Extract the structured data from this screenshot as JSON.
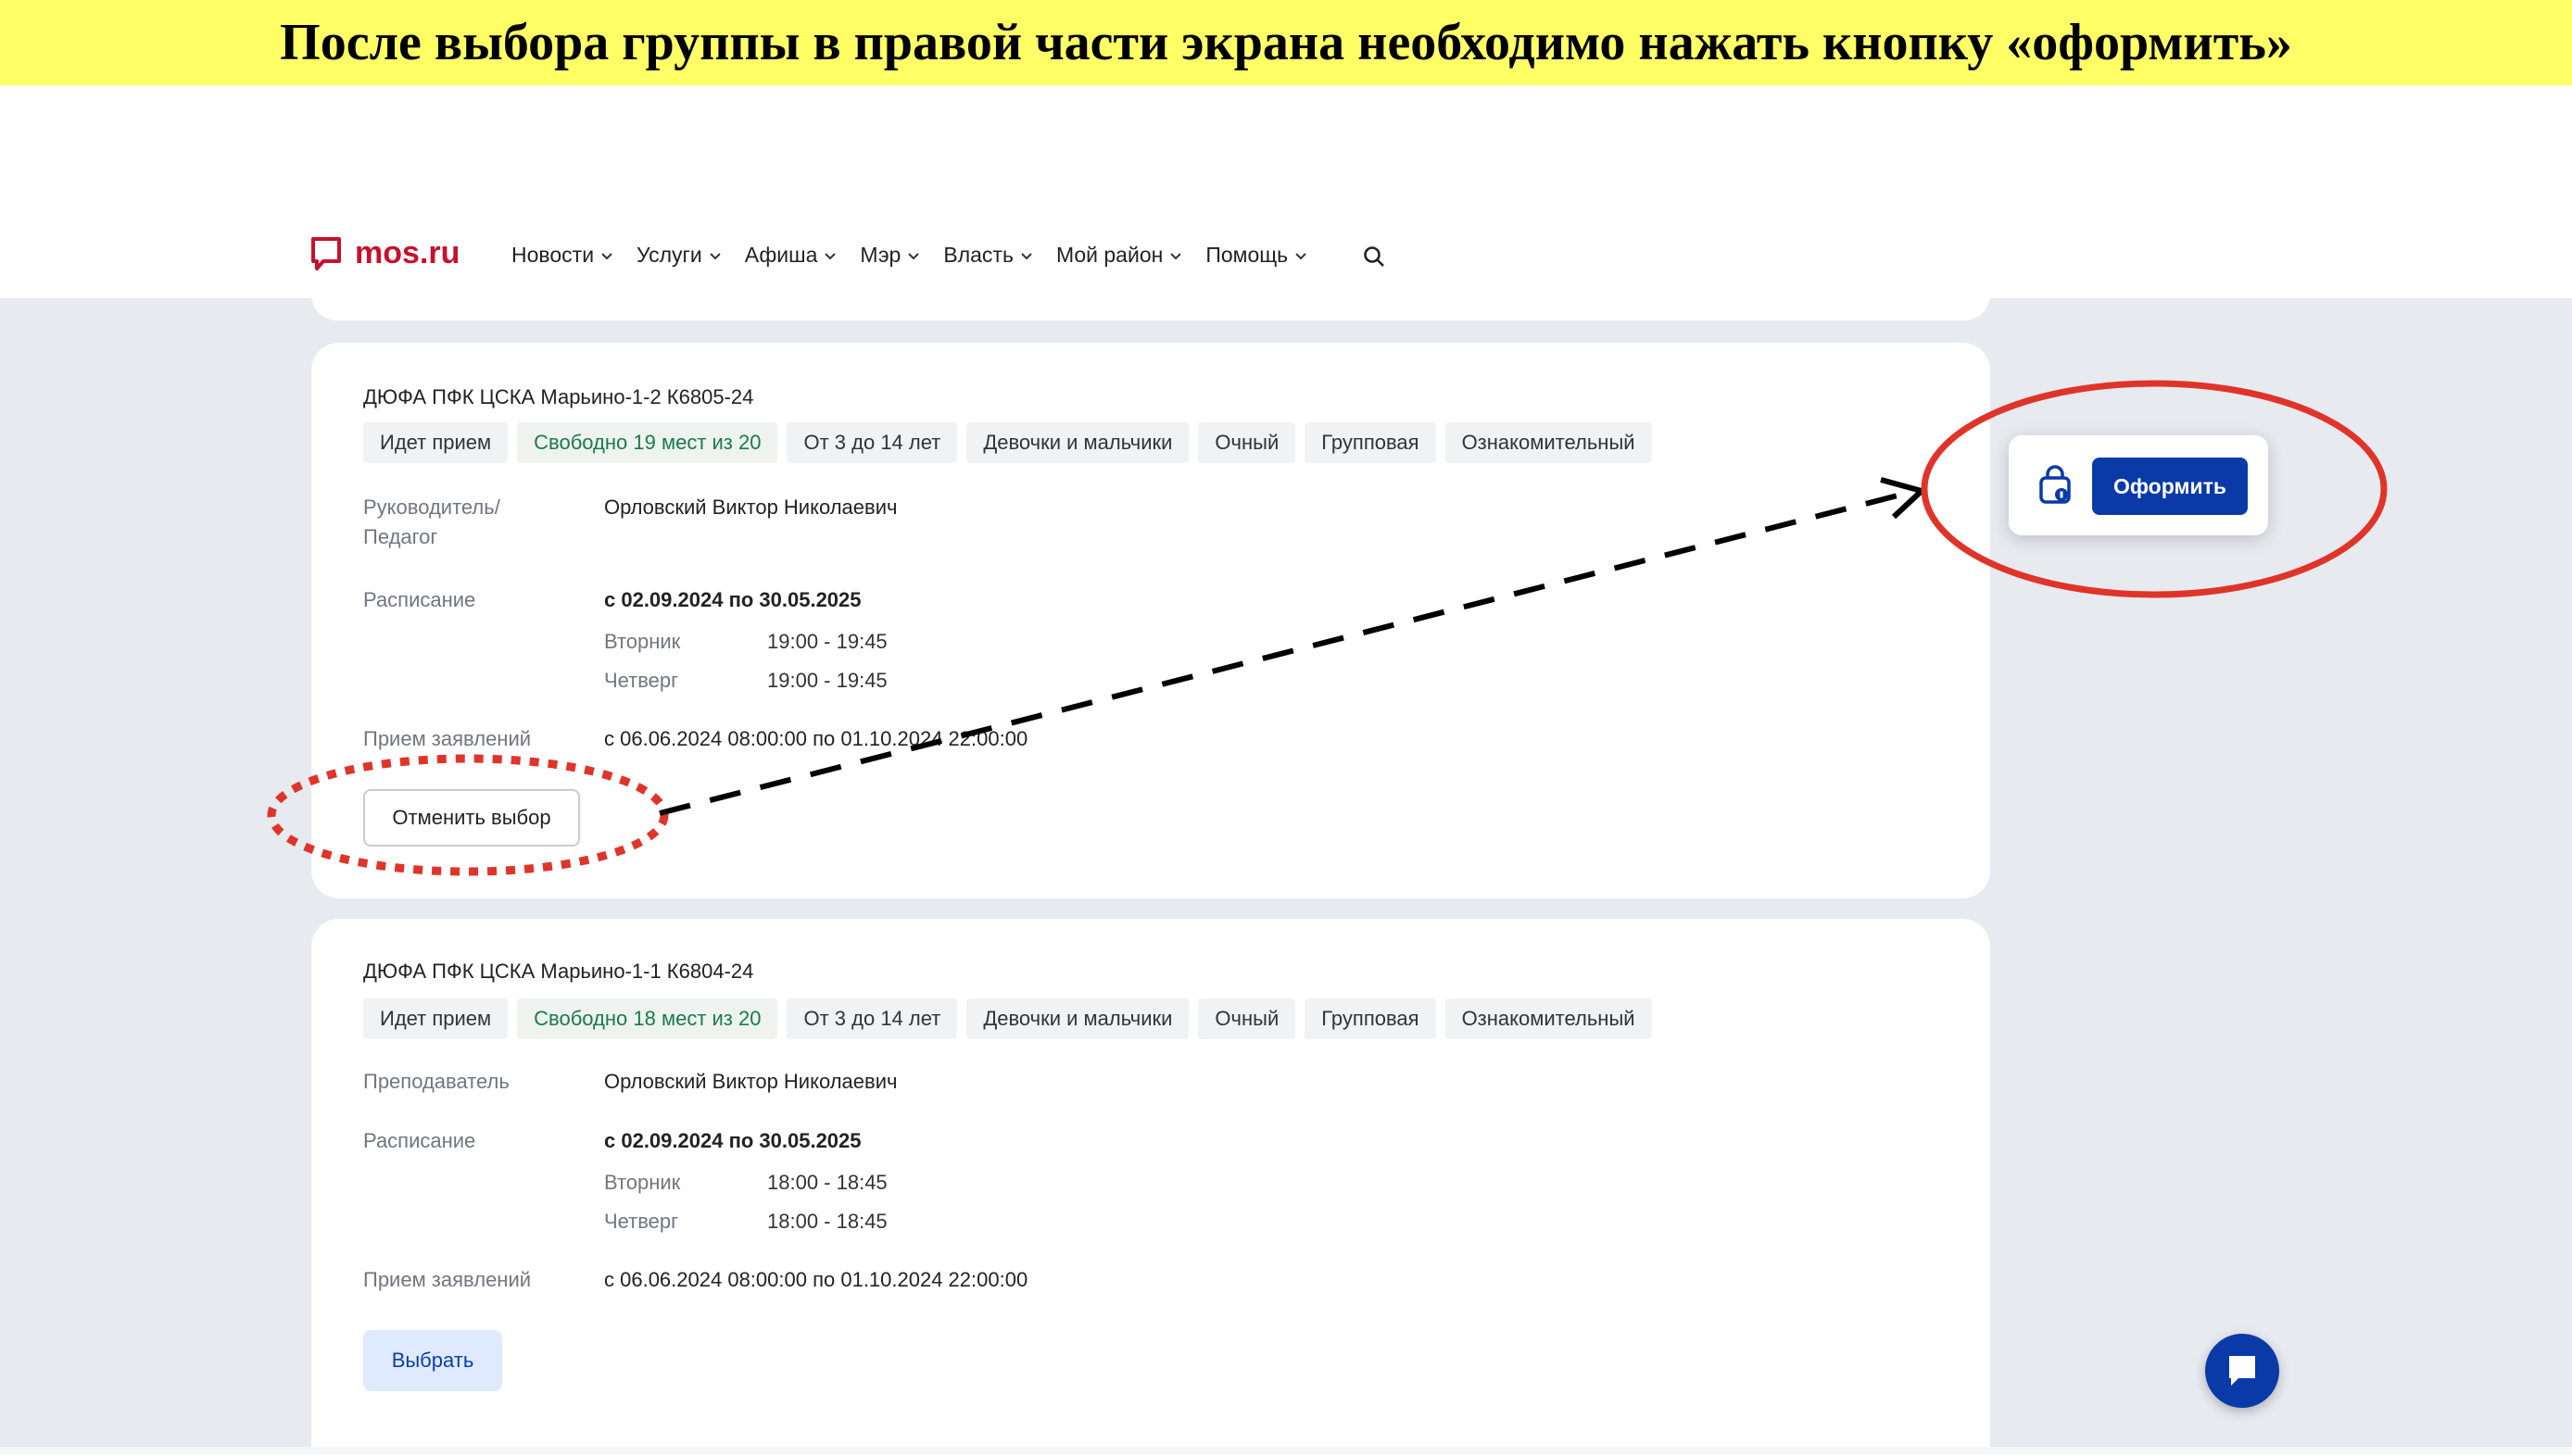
{
  "banner": {
    "text": "После выбора группы в правой части экрана необходимо нажать кнопку «оформить»"
  },
  "header": {
    "logo_text": "mos.ru",
    "nav": [
      {
        "label": "Новости"
      },
      {
        "label": "Услуги"
      },
      {
        "label": "Афиша"
      },
      {
        "label": "Мэр"
      },
      {
        "label": "Власть"
      },
      {
        "label": "Мой район"
      },
      {
        "label": "Помощь"
      }
    ],
    "search_icon": "search-icon"
  },
  "cards": [
    {
      "title": "ДЮФА ПФК ЦСКА Марьино-1-2 К6805-24",
      "tags": [
        "Идет прием",
        "Свободно 19 мест из 20",
        "От 3 до 14 лет",
        "Девочки и мальчики",
        "Очный",
        "Групповая",
        "Ознакомительный"
      ],
      "leader_label": "Руководитель/ Педагог",
      "leader_value": "Орловский Виктор Николаевич",
      "schedule_label": "Расписание",
      "schedule_period": "с 02.09.2024 по 30.05.2025",
      "days": [
        {
          "day": "Вторник",
          "time": "19:00 - 19:45"
        },
        {
          "day": "Четверг",
          "time": "19:00 - 19:45"
        }
      ],
      "applications_label": "Прием заявлений",
      "applications_value": "с 06.06.2024 08:00:00 по 01.10.2024 22:00:00",
      "button_label": "Отменить выбор"
    },
    {
      "title": "ДЮФА ПФК ЦСКА Марьино-1-1 К6804-24",
      "tags": [
        "Идет прием",
        "Свободно 18 мест из 20",
        "От 3 до 14 лет",
        "Девочки и мальчики",
        "Очный",
        "Групповая",
        "Ознакомительный"
      ],
      "leader_label": "Преподаватель",
      "leader_value": "Орловский Виктор Николаевич",
      "schedule_label": "Расписание",
      "schedule_period": "с 02.09.2024 по 30.05.2025",
      "days": [
        {
          "day": "Вторник",
          "time": "18:00 - 18:45"
        },
        {
          "day": "Четверг",
          "time": "18:00 - 18:45"
        }
      ],
      "applications_label": "Прием заявлений",
      "applications_value": "с 06.06.2024 08:00:00 по 01.10.2024 22:00:00",
      "button_label": "Выбрать"
    }
  ],
  "cart": {
    "button_label": "Оформить",
    "icon": "cart-lock-icon"
  },
  "chat": {
    "icon": "chat-icon"
  },
  "colors": {
    "brand_red": "#c8102e",
    "primary_blue": "#0a3aa8",
    "annotation_red": "#e0342a",
    "banner_yellow": "#ffff66"
  }
}
